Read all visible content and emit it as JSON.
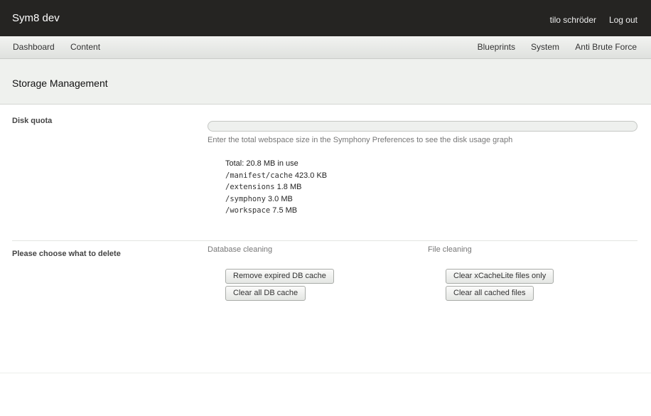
{
  "header": {
    "brand": "Sym8 dev",
    "user": "tilo schröder",
    "logout": "Log out"
  },
  "nav": {
    "left": [
      "Dashboard",
      "Content"
    ],
    "right": [
      "Blueprints",
      "System",
      "Anti Brute Force"
    ]
  },
  "page": {
    "title": "Storage Management"
  },
  "disk_quota": {
    "label": "Disk quota",
    "usage_fraction": 0,
    "hint": "Enter the total webspace size in the Symphony Preferences to see the disk usage graph",
    "total": "Total: 20.8 MB in use",
    "entries": [
      {
        "path": "/manifest/cache",
        "size": "423.0 KB"
      },
      {
        "path": "/extensions",
        "size": "1.8 MB"
      },
      {
        "path": "/symphony",
        "size": "3.0 MB"
      },
      {
        "path": "/workspace",
        "size": "7.5 MB"
      }
    ]
  },
  "delete": {
    "label": "Please choose what to delete",
    "database": {
      "heading": "Database cleaning",
      "buttons": [
        "Remove expired DB cache",
        "Clear all DB cache"
      ]
    },
    "files": {
      "heading": "File cleaning",
      "buttons": [
        "Clear xCacheLite files only",
        "Clear all cached files"
      ]
    }
  },
  "colors": {
    "topbar": "#252422",
    "navbar": "#e8eae7",
    "header_bg": "#eff1ee"
  }
}
